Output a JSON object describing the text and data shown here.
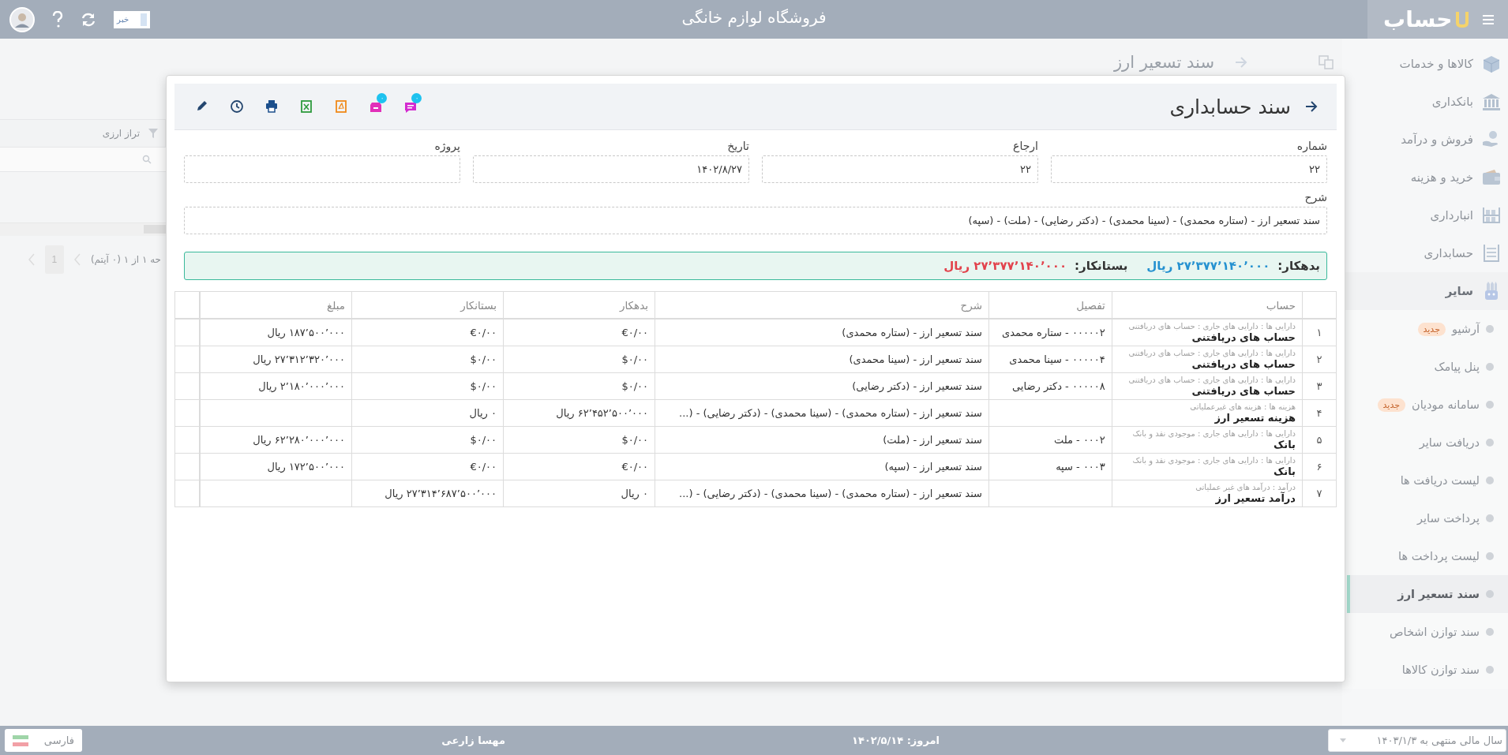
{
  "top_bar": {
    "logo": "حساب",
    "title": "فروشگاه لوازم خانگی",
    "news_button": "خبر"
  },
  "sidebar": {
    "items": [
      {
        "label": "کالاها و خدمات",
        "expanded": false
      },
      {
        "label": "بانکداری",
        "expanded": false
      },
      {
        "label": "فروش و درآمد",
        "expanded": false
      },
      {
        "label": "خرید و هزینه",
        "expanded": false
      },
      {
        "label": "انبارداری",
        "expanded": false
      },
      {
        "label": "حسابداری",
        "expanded": false
      },
      {
        "label": "سایر",
        "expanded": true,
        "children": [
          {
            "label": "آرشیو",
            "badge": "جدید",
            "selected": false
          },
          {
            "label": "پنل پیامک",
            "selected": false
          },
          {
            "label": "سامانه مودیان",
            "badge": "جدید",
            "selected": false
          },
          {
            "label": "دریافت سایر",
            "selected": false
          },
          {
            "label": "لیست دریافت ها",
            "selected": false
          },
          {
            "label": "پرداخت سایر",
            "selected": false
          },
          {
            "label": "لیست پرداخت ها",
            "selected": false
          },
          {
            "label": "سند تسعیر ارز",
            "selected": true
          },
          {
            "label": "سند توازن اشخاص",
            "selected": false
          },
          {
            "label": "سند توازن کالاها",
            "selected": false
          }
        ]
      }
    ]
  },
  "background_page": {
    "title": "سند تسعیر ارز",
    "filter_column": "تراز ارزی",
    "page_button": "1",
    "pager_text": "حه ۱ از ۱ (۰ آیتم)"
  },
  "modal": {
    "title": "سند حسابداری",
    "toolbar": [
      {
        "kind": "comment",
        "badge": "۰"
      },
      {
        "kind": "archive",
        "badge": "۰"
      },
      {
        "kind": "pdf"
      },
      {
        "kind": "excel"
      },
      {
        "kind": "print"
      },
      {
        "kind": "history"
      },
      {
        "kind": "edit"
      }
    ],
    "fields": [
      {
        "label": "شماره",
        "value": "۲۲"
      },
      {
        "label": "ارجاع",
        "value": "۲۲"
      },
      {
        "label": "تاریخ",
        "value": "۱۴۰۲/۸/۲۷"
      },
      {
        "label": "پروژه"
      }
    ],
    "description": {
      "label": "شرح",
      "value": "سند تسعیر ارز - (ستاره محمدی) - (سینا محمدی) - (دکتر رضایی) - (ملت) - (سپه)"
    },
    "totals": {
      "debit_label": "بدهکار:",
      "debit": "۲۷٬۳۷۷٬۱۴۰٬۰۰۰ ریال",
      "credit_label": "بستانکار:",
      "credit": "۲۷٬۳۷۷٬۱۴۰٬۰۰۰ ریال"
    },
    "table": {
      "columns": [
        "حساب",
        "تفصیل",
        "شرح",
        "بدهکار",
        "بستانکار",
        "مبلغ"
      ],
      "rows": [
        {
          "number": "۱",
          "account_path": "دارایی ها : دارایی های جاری : حساب های دریافتنی",
          "account": "حساب های دریافتنی",
          "detail": "۰۰۰۰۰۲ - ستاره محمدی",
          "description": "سند تسعیر ارز - (ستاره محمدی)",
          "debit": "€۰/۰۰",
          "credit": "€۰/۰۰",
          "amount": "۱۸۷٬۵۰۰٬۰۰۰ ریال"
        },
        {
          "number": "۲",
          "account_path": "دارایی ها : دارایی های جاری : حساب های دریافتنی",
          "account": "حساب های دریافتنی",
          "detail": "۰۰۰۰۰۴ - سینا محمدی",
          "description": "سند تسعیر ارز - (سینا محمدی)",
          "debit": "$۰/۰۰",
          "credit": "$۰/۰۰",
          "amount": "۲۷٬۳۱۲٬۳۲۰٬۰۰۰ ریال"
        },
        {
          "number": "۳",
          "account_path": "دارایی ها : دارایی های جاری : حساب های دریافتنی",
          "account": "حساب های دریافتنی",
          "detail": "۰۰۰۰۰۸ - دکتر رضایی",
          "description": "سند تسعیر ارز - (دکتر رضایی)",
          "debit": "$۰/۰۰",
          "credit": "$۰/۰۰",
          "amount": "۲٬۱۸۰٬۰۰۰٬۰۰۰ ریال"
        },
        {
          "number": "۴",
          "account_path": "هزینه ها : هزینه های غیرعملیاتی",
          "account": "هزینه تسعیر ارز",
          "description": "سند تسعیر ارز - (ستاره محمدی) - (سینا محمدی) - (دکتر رضایی) - (...",
          "debit": "۶۲٬۴۵۲٬۵۰۰٬۰۰۰ ریال",
          "credit": "۰ ریال"
        },
        {
          "number": "۵",
          "account_path": "دارایی ها : دارایی های جاری : موجودی نقد و بانک",
          "account": "بانک",
          "detail": "۰۰۰۲ - ملت",
          "description": "سند تسعیر ارز - (ملت)",
          "debit": "$۰/۰۰",
          "credit": "$۰/۰۰",
          "amount": "۶۲٬۲۸۰٬۰۰۰٬۰۰۰ ریال"
        },
        {
          "number": "۶",
          "account_path": "دارایی ها : دارایی های جاری : موجودی نقد و بانک",
          "account": "بانک",
          "detail": "۰۰۰۳ - سپه",
          "description": "سند تسعیر ارز - (سپه)",
          "debit": "€۰/۰۰",
          "credit": "€۰/۰۰",
          "amount": "۱۷۲٬۵۰۰٬۰۰۰ ریال"
        },
        {
          "number": "۷",
          "account_path": "درآمد : درآمد های غیر عملیاتی",
          "account": "درآمد تسعیر ارز",
          "description": "سند تسعیر ارز - (ستاره محمدی) - (سینا محمدی) - (دکتر رضایی) - (...",
          "debit": "۰ ریال",
          "credit": "۲۷٬۳۱۴٬۶۸۷٬۵۰۰٬۰۰۰ ریال"
        }
      ]
    }
  },
  "footer": {
    "fiscal_year": "سال مالی منتهی به ۱۴۰۳/۱/۳",
    "today": "امروز: ۱۴۰۲/۵/۱۴",
    "user": "مهسا زارعی",
    "language": "فارسی"
  }
}
